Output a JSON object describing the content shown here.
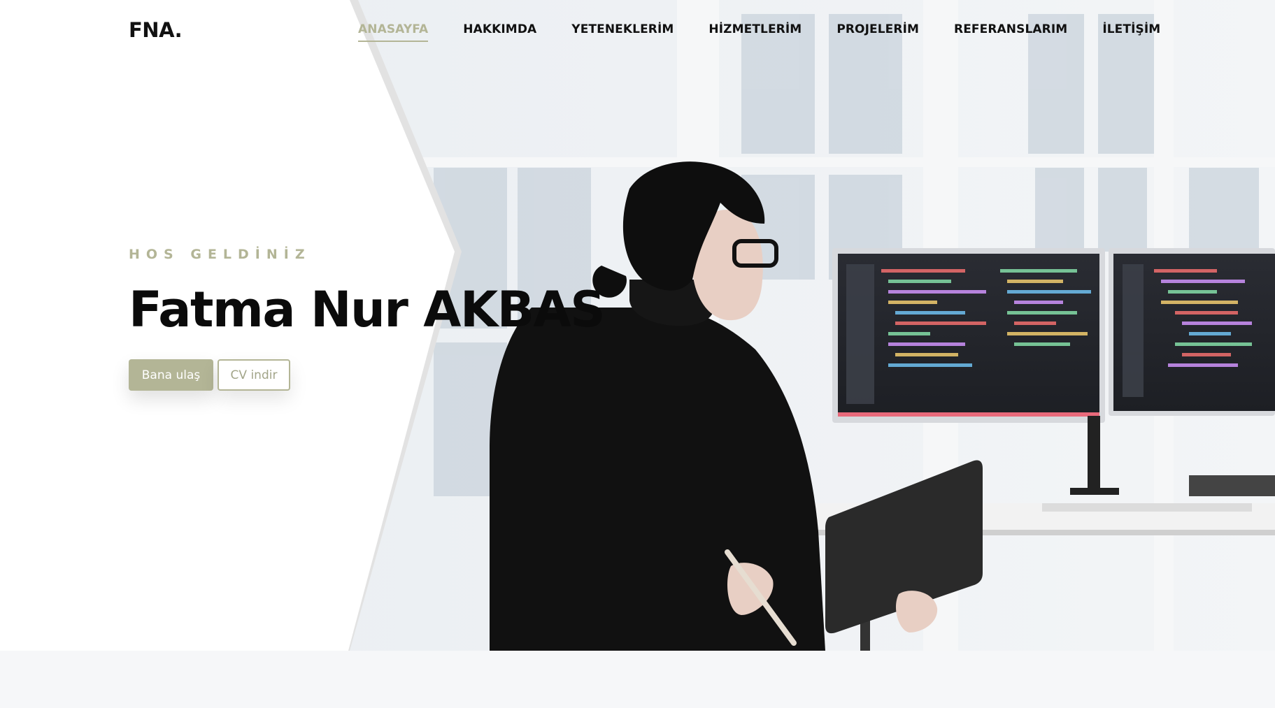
{
  "header": {
    "logo": "FNA.",
    "nav": [
      {
        "label": "ANASAYFA",
        "active": true
      },
      {
        "label": "HAKKIMDA",
        "active": false
      },
      {
        "label": "YETENEKLERİM",
        "active": false
      },
      {
        "label": "HİZMETLERİM",
        "active": false
      },
      {
        "label": "PROJELERİM",
        "active": false
      },
      {
        "label": "REFERANSLARIM",
        "active": false
      },
      {
        "label": "İLETİŞİM",
        "active": false
      }
    ]
  },
  "hero": {
    "eyebrow": "HOS GELDİNİZ",
    "name": "Fatma Nur AKBAS",
    "primary_button": "Bana ulaş",
    "secondary_button": "CV indir"
  },
  "colors": {
    "accent": "#b3b596",
    "text": "#0b0b0b",
    "background": "#ffffff",
    "section_background": "#f6f7f9"
  }
}
